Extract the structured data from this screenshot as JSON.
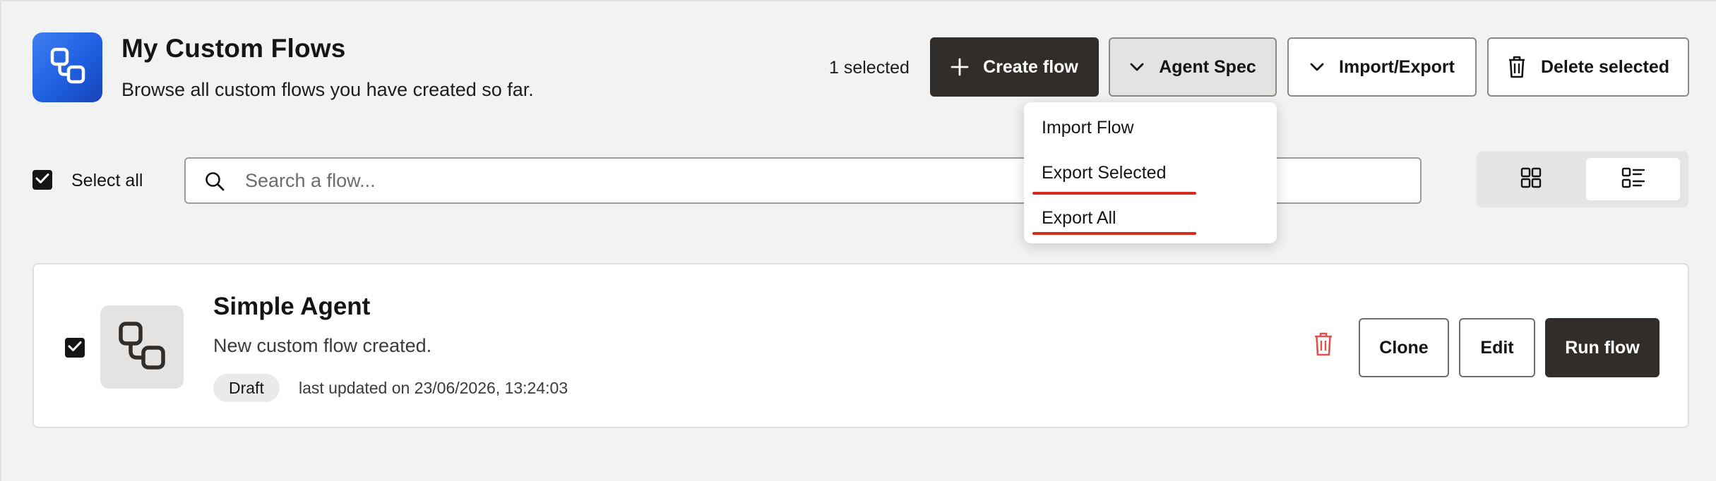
{
  "header": {
    "title": "My Custom Flows",
    "subtitle": "Browse all custom flows you have created so far.",
    "selected_count": "1 selected",
    "logo_icon": "flow-nodes-icon"
  },
  "toolbar": {
    "create_label": "Create flow",
    "agent_spec_label": "Agent Spec",
    "import_export_label": "Import/Export",
    "delete_selected_label": "Delete selected"
  },
  "dropdown": {
    "items": [
      {
        "label": "Import Flow"
      },
      {
        "label": "Export Selected"
      },
      {
        "label": "Export All"
      }
    ]
  },
  "filters": {
    "select_all_label": "Select all",
    "select_all_checked": true,
    "search_placeholder": "Search a flow...",
    "search_value": "",
    "view_mode": "list"
  },
  "flows": [
    {
      "name": "Simple Agent",
      "description": "New custom flow created.",
      "status": "Draft",
      "updated": "last updated on 23/06/2026, 13:24:03",
      "checked": true,
      "actions": {
        "clone": "Clone",
        "edit": "Edit",
        "run": "Run flow"
      }
    }
  ],
  "colors": {
    "background": "#f2f2f2",
    "primary_dark": "#312d2a",
    "logo_blue": "#2a6ae8",
    "danger": "#d62c1f",
    "trash_red": "#d9534f"
  }
}
